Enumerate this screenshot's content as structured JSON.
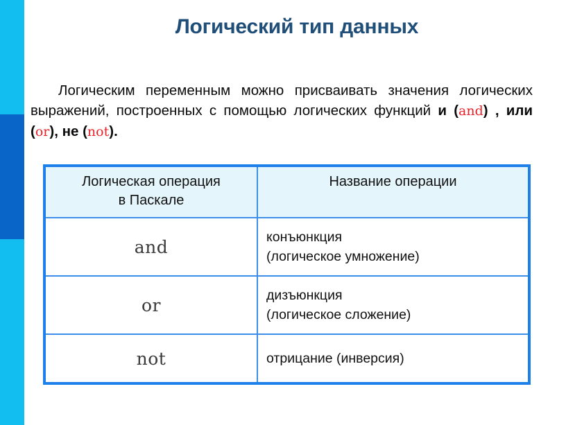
{
  "theme": {
    "accent_cyan": "#12BEF0",
    "accent_blue": "#0A65C8",
    "title_color": "#1F4E79",
    "table_border": "#1D7FE8",
    "table_header_bg": "#E4F5FB",
    "keyword_color": "#E8232A"
  },
  "slide": {
    "title": "Логический тип данных"
  },
  "paragraph": {
    "part1": "Логическим переменным можно присваивать значения логических выражений, построенных с помощью логических функций ",
    "bold1": "и",
    "open1": "(",
    "kw1": "and",
    "close1": ")",
    "sep1": " , ",
    "bold2": "или",
    "open2": "(",
    "kw2": "or",
    "close2": ")",
    "sep2": ", ",
    "bold3": "не",
    "open3": "(",
    "kw3": "not",
    "close3": ")",
    "end": "."
  },
  "table": {
    "headers": {
      "operation_line1": "Логическая операция",
      "operation_line2": "в Паскале",
      "name": "Название операции"
    },
    "rows": [
      {
        "operation": "and",
        "name_line1": "конъюнкция",
        "name_line2": "(логическое умножение)"
      },
      {
        "operation": "or",
        "name_line1": "дизъюнкция",
        "name_line2": "(логическое сложение)"
      },
      {
        "operation": "not",
        "name_line1": "отрицание (инверсия)",
        "name_line2": ""
      }
    ]
  }
}
